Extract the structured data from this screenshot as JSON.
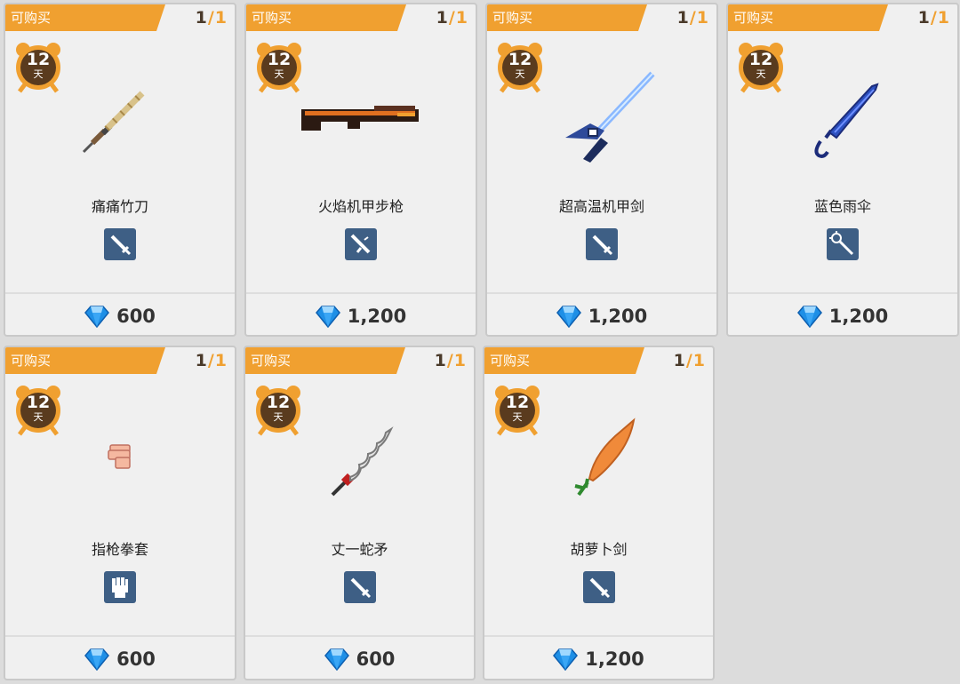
{
  "shop": {
    "items": [
      {
        "badge": "可购买",
        "stock_current": "1",
        "stock_sep": "/",
        "stock_max": "1",
        "timer_value": "12",
        "timer_unit": "天",
        "name": "痛痛竹刀",
        "type_icon": "sword-icon",
        "price": "600",
        "currency_icon": "diamond-icon",
        "sprite": "bamboo-sword"
      },
      {
        "badge": "可购买",
        "stock_current": "1",
        "stock_sep": "/",
        "stock_max": "1",
        "timer_value": "12",
        "timer_unit": "天",
        "name": "火焰机甲步枪",
        "type_icon": "rifle-icon",
        "price": "1,200",
        "currency_icon": "diamond-icon",
        "sprite": "flame-rifle"
      },
      {
        "badge": "可购买",
        "stock_current": "1",
        "stock_sep": "/",
        "stock_max": "1",
        "timer_value": "12",
        "timer_unit": "天",
        "name": "超高温机甲剑",
        "type_icon": "sword-icon",
        "price": "1,200",
        "currency_icon": "diamond-icon",
        "sprite": "mech-sword"
      },
      {
        "badge": "可购买",
        "stock_current": "1",
        "stock_sep": "/",
        "stock_max": "1",
        "timer_value": "12",
        "timer_unit": "天",
        "name": "蓝色雨伞",
        "type_icon": "staff-icon",
        "price": "1,200",
        "currency_icon": "diamond-icon",
        "sprite": "blue-umbrella"
      },
      {
        "badge": "可购买",
        "stock_current": "1",
        "stock_sep": "/",
        "stock_max": "1",
        "timer_value": "12",
        "timer_unit": "天",
        "name": "指枪拳套",
        "type_icon": "fist-icon",
        "price": "600",
        "currency_icon": "diamond-icon",
        "sprite": "finger-glove"
      },
      {
        "badge": "可购买",
        "stock_current": "1",
        "stock_sep": "/",
        "stock_max": "1",
        "timer_value": "12",
        "timer_unit": "天",
        "name": "丈一蛇矛",
        "type_icon": "sword-icon",
        "price": "600",
        "currency_icon": "diamond-icon",
        "sprite": "serpent-spear"
      },
      {
        "badge": "可购买",
        "stock_current": "1",
        "stock_sep": "/",
        "stock_max": "1",
        "timer_value": "12",
        "timer_unit": "天",
        "name": "胡萝卜剑",
        "type_icon": "sword-icon",
        "price": "1,200",
        "currency_icon": "diamond-icon",
        "sprite": "carrot-sword"
      }
    ]
  },
  "colors": {
    "badge": "#f0a030",
    "card": "#f0f0f0",
    "type_icon_bg": "#3e5f85",
    "diamond": "#1e8fe6",
    "clock": "#5a3b1e"
  }
}
